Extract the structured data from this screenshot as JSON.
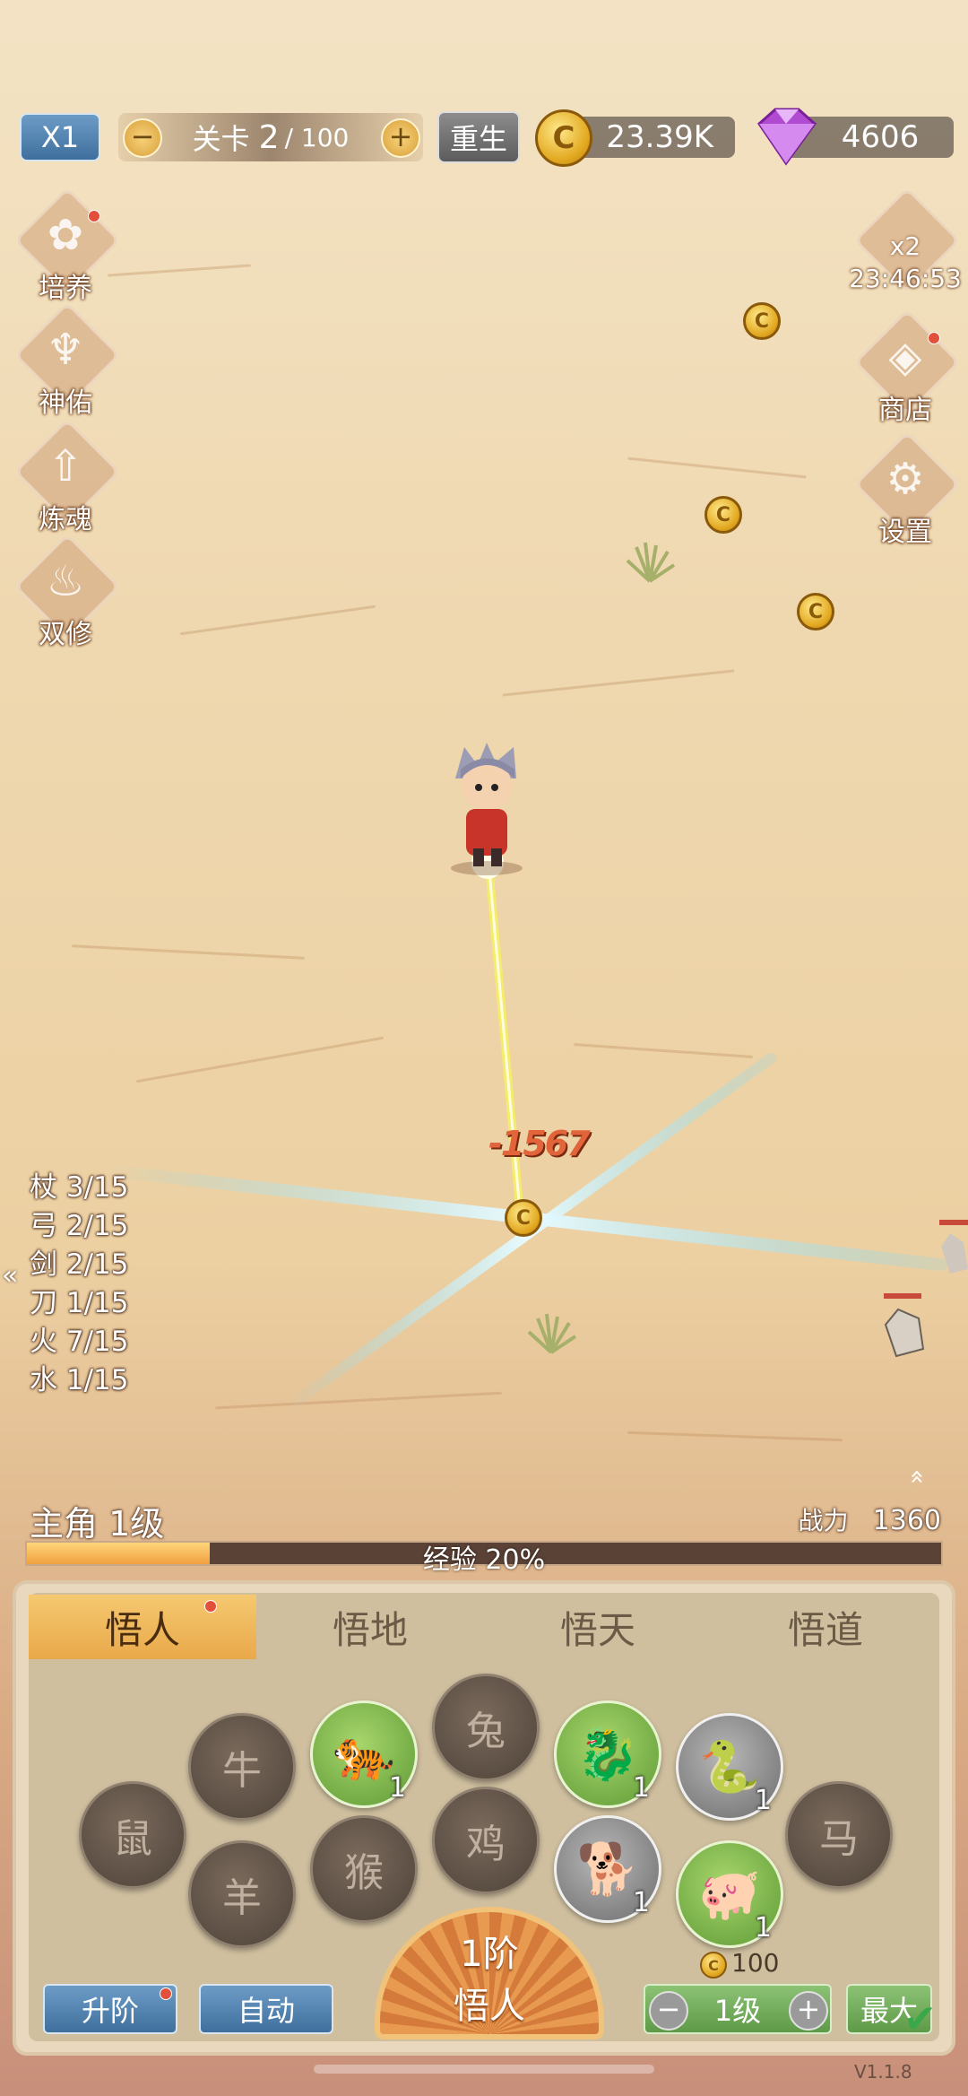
{
  "top_bar": {
    "speed": "X1",
    "stage_label": "关卡",
    "stage_current": "2",
    "stage_total": "/ 100",
    "rebirth": "重生",
    "gold": "23.39K",
    "gems": "4606"
  },
  "left_menu": [
    "培养",
    "神佑",
    "炼魂",
    "双修"
  ],
  "right_menu": {
    "boost_label": "x2",
    "boost_timer": "23:46:53",
    "shop": "商店",
    "settings": "设置"
  },
  "damage_text": "-1567",
  "weapon_stats": [
    "杖 3/15",
    "弓 2/15",
    "剑 2/15",
    "刀 1/15",
    "火 7/15",
    "水 1/15"
  ],
  "hero": {
    "level_label": "主角 1级",
    "power_label": "战力",
    "power_value": "1360",
    "exp_label": "经验 20%",
    "exp_fraction": 0.2
  },
  "tabs": [
    "悟人",
    "悟地",
    "悟天",
    "悟道"
  ],
  "zodiac": {
    "rat": "鼠",
    "ox": "牛",
    "sheep": "羊",
    "monkey": "猴",
    "rabbit": "兔",
    "rooster": "鸡",
    "horse": "马",
    "tiger_level": "1",
    "dragon_level": "1",
    "snake_level": "1",
    "dog_level": "1",
    "pig_level": "1"
  },
  "footer": {
    "upgrade": "升阶",
    "auto": "自动",
    "rank": "1阶",
    "rank_name": "悟人",
    "cost": "100",
    "level": "1级",
    "max": "最大",
    "version": "V1.1.8"
  },
  "colors": {
    "accent_orange": "#e9a94a",
    "blue_button": "#3f6f9c",
    "green_button": "#5e9a36"
  }
}
